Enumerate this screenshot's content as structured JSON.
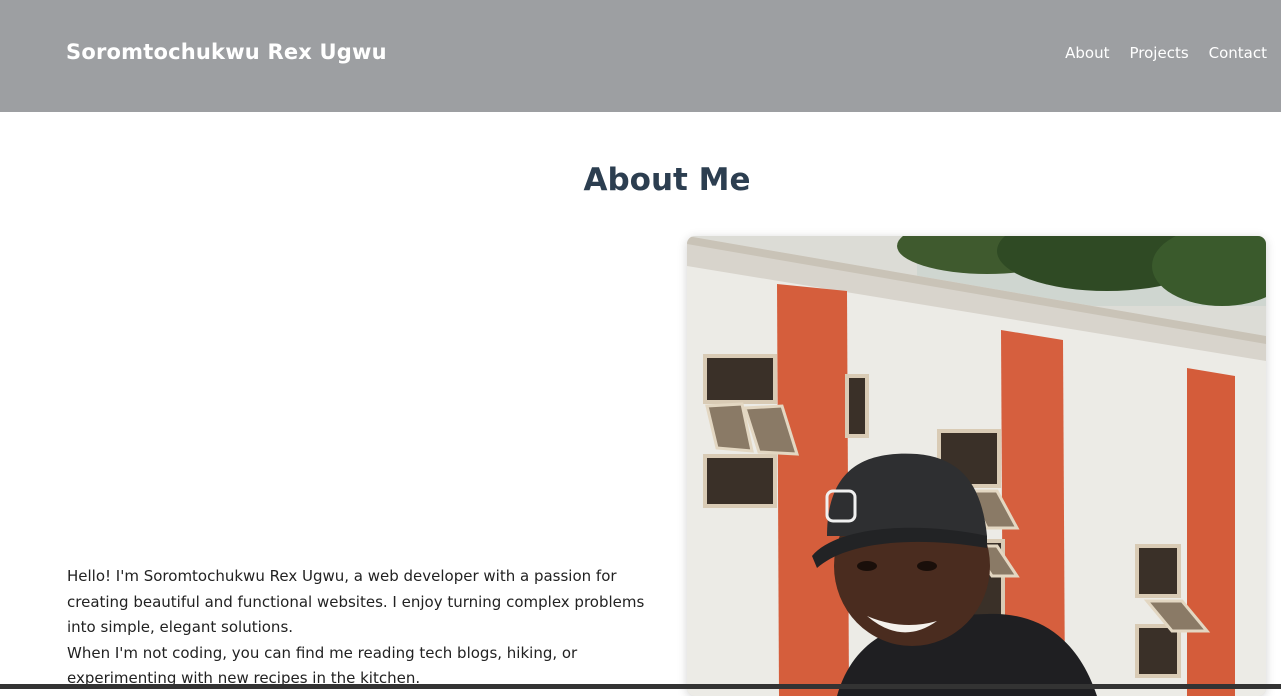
{
  "header": {
    "brand": "Soromtochukwu Rex Ugwu",
    "nav": [
      {
        "label": "About"
      },
      {
        "label": "Projects"
      },
      {
        "label": "Contact"
      }
    ]
  },
  "about": {
    "title": "About Me",
    "paragraph1": "Hello! I'm Soromtochukwu Rex Ugwu, a web developer with a passion for creating beautiful and functional websites. I enjoy turning complex problems into simple, elegant solutions.",
    "paragraph2": "When I'm not coding, you can find me reading tech blogs, hiking, or experimenting with new recipes in the kitchen."
  },
  "colors": {
    "header_bg": "#9d9fa2",
    "title": "#2c3e50",
    "pillar": "#d9603e"
  }
}
